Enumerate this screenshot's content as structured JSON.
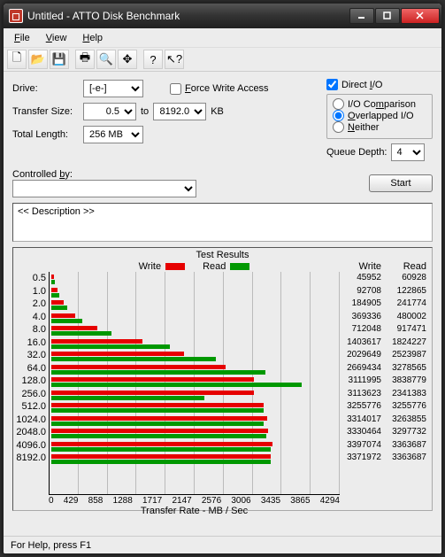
{
  "window": {
    "title": "Untitled - ATTO Disk Benchmark"
  },
  "menu": {
    "file": "File",
    "view": "View",
    "help": "Help"
  },
  "form": {
    "drive_label": "Drive:",
    "drive_value": "[-e-]",
    "transfer_label": "Transfer Size:",
    "transfer_from": "0.5",
    "transfer_to_label": "to",
    "transfer_to": "8192.0",
    "transfer_unit": "KB",
    "total_length_label": "Total Length:",
    "total_length_value": "256 MB",
    "force_write_label": "Force Write Access",
    "direct_io_label": "Direct I/O",
    "io_comparison_label": "I/O Comparison",
    "overlapped_io_label": "Overlapped I/O",
    "neither_label": "Neither",
    "queue_depth_label": "Queue Depth:",
    "queue_depth_value": "4",
    "controlled_by_label": "Controlled by:",
    "controlled_by_value": "",
    "start_label": "Start"
  },
  "description": {
    "header": "<< Description >>",
    "content": ""
  },
  "results": {
    "title": "Test Results",
    "write_label": "Write",
    "read_label": "Read",
    "x_axis_label": "Transfer Rate - MB / Sec"
  },
  "chart_data": {
    "type": "bar",
    "x_axis": "Transfer Rate - MB / Sec",
    "x_ticks": [
      0,
      429,
      858,
      1288,
      1717,
      2147,
      2576,
      3006,
      3435,
      3865,
      4294
    ],
    "xlim": [
      0,
      4294
    ],
    "categories": [
      "0.5",
      "1.0",
      "2.0",
      "4.0",
      "8.0",
      "16.0",
      "32.0",
      "64.0",
      "128.0",
      "256.0",
      "512.0",
      "1024.0",
      "2048.0",
      "4096.0",
      "8192.0"
    ],
    "series": [
      {
        "name": "Write",
        "color": "#e60000",
        "values_kbs": [
          45952,
          92708,
          184905,
          369336,
          712048,
          1403617,
          2029649,
          2669434,
          3111995,
          3113623,
          3255776,
          3314017,
          3330464,
          3397074,
          3371972
        ]
      },
      {
        "name": "Read",
        "color": "#009800",
        "values_kbs": [
          60928,
          122865,
          241774,
          480002,
          917471,
          1824227,
          2523987,
          3278565,
          3838779,
          2341383,
          3255776,
          3263855,
          3297732,
          3363687,
          3363687
        ]
      }
    ]
  },
  "statusbar": {
    "text": "For Help, press F1"
  }
}
